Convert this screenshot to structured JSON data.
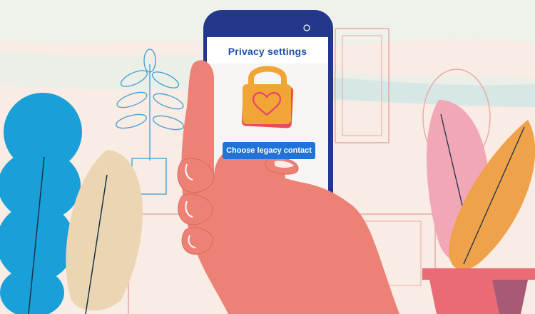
{
  "screen": {
    "title": "Privacy settings",
    "primary_button_label": "Choose legacy contact",
    "icon": "padlock-heart-icon"
  },
  "colors": {
    "title_text": "#1f4fa8",
    "button": "#1e74d9",
    "phone_body": "#23388a",
    "padlock": "#f0a536",
    "heart": "#e8436a",
    "hand": "#ee8175"
  }
}
